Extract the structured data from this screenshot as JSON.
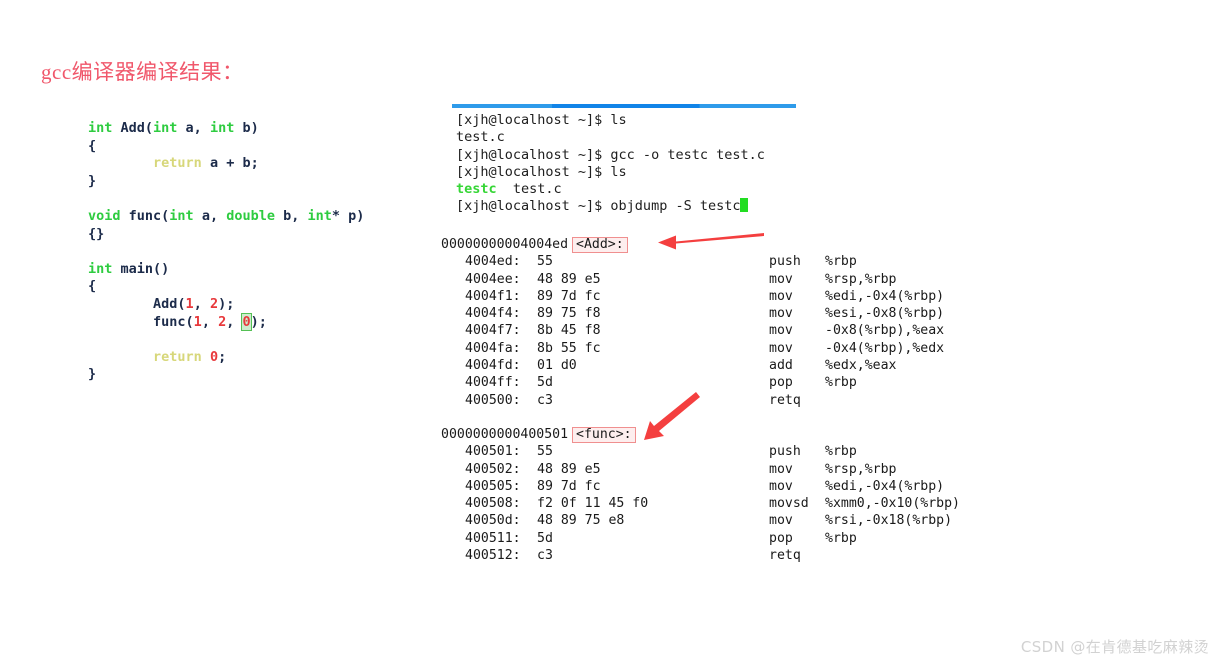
{
  "slide": {
    "title": "gcc编译器编译结果：",
    "title_color": "#f0576b"
  },
  "source_code": {
    "language": "c",
    "lines": [
      [
        {
          "t": "int",
          "c": "kw"
        },
        {
          "t": " Add(",
          "c": "id"
        },
        {
          "t": "int",
          "c": "kw"
        },
        {
          "t": " a, ",
          "c": "id"
        },
        {
          "t": "int",
          "c": "kw"
        },
        {
          "t": " b)",
          "c": "id"
        }
      ],
      [
        {
          "t": "{",
          "c": "id"
        }
      ],
      [
        {
          "t": "        ",
          "c": "id"
        },
        {
          "t": "return",
          "c": "ret"
        },
        {
          "t": " a + b;",
          "c": "id"
        }
      ],
      [
        {
          "t": "}",
          "c": "id"
        }
      ],
      [],
      [
        {
          "t": "void",
          "c": "kw"
        },
        {
          "t": " func(",
          "c": "id"
        },
        {
          "t": "int",
          "c": "kw"
        },
        {
          "t": " a, ",
          "c": "id"
        },
        {
          "t": "double",
          "c": "kw"
        },
        {
          "t": " b, ",
          "c": "id"
        },
        {
          "t": "int",
          "c": "kw"
        },
        {
          "t": "* p)",
          "c": "id"
        }
      ],
      [
        {
          "t": "{}",
          "c": "id"
        }
      ],
      [],
      [
        {
          "t": "int",
          "c": "kw"
        },
        {
          "t": " main()",
          "c": "id"
        }
      ],
      [
        {
          "t": "{",
          "c": "id"
        }
      ],
      [
        {
          "t": "        Add(",
          "c": "id"
        },
        {
          "t": "1",
          "c": "num"
        },
        {
          "t": ", ",
          "c": "id"
        },
        {
          "t": "2",
          "c": "num"
        },
        {
          "t": ");",
          "c": "id"
        }
      ],
      [
        {
          "t": "        func(",
          "c": "id"
        },
        {
          "t": "1",
          "c": "num"
        },
        {
          "t": ", ",
          "c": "id"
        },
        {
          "t": "2",
          "c": "num"
        },
        {
          "t": ", ",
          "c": "id"
        },
        {
          "t": "0",
          "c": "hl-zero"
        },
        {
          "t": ");",
          "c": "id"
        }
      ],
      [],
      [
        {
          "t": "        ",
          "c": "id"
        },
        {
          "t": "return",
          "c": "ret"
        },
        {
          "t": " ",
          "c": "id"
        },
        {
          "t": "0",
          "c": "num"
        },
        {
          "t": ";",
          "c": "id"
        }
      ],
      [
        {
          "t": "}",
          "c": "id"
        }
      ]
    ]
  },
  "terminal": {
    "prompt": "[xjh@localhost ~]$",
    "lines": [
      [
        {
          "t": "[xjh@localhost ~]$ ls",
          "c": "plain"
        }
      ],
      [
        {
          "t": "test.c",
          "c": "plain"
        }
      ],
      [
        {
          "t": "[xjh@localhost ~]$ gcc -o testc test.c",
          "c": "plain"
        }
      ],
      [
        {
          "t": "[xjh@localhost ~]$ ls",
          "c": "plain"
        }
      ],
      [
        {
          "t": "testc",
          "c": "exe"
        },
        {
          "t": "  test.c",
          "c": "plain"
        }
      ],
      [
        {
          "t": "[xjh@localhost ~]$ objdump -S testc",
          "c": "plain"
        },
        {
          "t": "",
          "c": "cursor"
        }
      ]
    ],
    "executable_color": "#36d636",
    "cursor_color": "#22dd22"
  },
  "disassembly": [
    {
      "id": "add",
      "address": "00000000004004ed",
      "symbol": "<Add>:",
      "instructions": [
        {
          "addr": "4004ed:",
          "bytes": "55",
          "mnemonic": "push",
          "operands": "%rbp"
        },
        {
          "addr": "4004ee:",
          "bytes": "48 89 e5",
          "mnemonic": "mov",
          "operands": "%rsp,%rbp"
        },
        {
          "addr": "4004f1:",
          "bytes": "89 7d fc",
          "mnemonic": "mov",
          "operands": "%edi,-0x4(%rbp)"
        },
        {
          "addr": "4004f4:",
          "bytes": "89 75 f8",
          "mnemonic": "mov",
          "operands": "%esi,-0x8(%rbp)"
        },
        {
          "addr": "4004f7:",
          "bytes": "8b 45 f8",
          "mnemonic": "mov",
          "operands": "-0x8(%rbp),%eax"
        },
        {
          "addr": "4004fa:",
          "bytes": "8b 55 fc",
          "mnemonic": "mov",
          "operands": "-0x4(%rbp),%edx"
        },
        {
          "addr": "4004fd:",
          "bytes": "01 d0",
          "mnemonic": "add",
          "operands": "%edx,%eax"
        },
        {
          "addr": "4004ff:",
          "bytes": "5d",
          "mnemonic": "pop",
          "operands": "%rbp"
        },
        {
          "addr": "400500:",
          "bytes": "c3",
          "mnemonic": "retq",
          "operands": ""
        }
      ]
    },
    {
      "id": "func",
      "address": "0000000000400501",
      "symbol": "<func>:",
      "instructions": [
        {
          "addr": "400501:",
          "bytes": "55",
          "mnemonic": "push",
          "operands": "%rbp"
        },
        {
          "addr": "400502:",
          "bytes": "48 89 e5",
          "mnemonic": "mov",
          "operands": "%rsp,%rbp"
        },
        {
          "addr": "400505:",
          "bytes": "89 7d fc",
          "mnemonic": "mov",
          "operands": "%edi,-0x4(%rbp)"
        },
        {
          "addr": "400508:",
          "bytes": "f2 0f 11 45 f0",
          "mnemonic": "movsd",
          "operands": "%xmm0,-0x10(%rbp)"
        },
        {
          "addr": "40050d:",
          "bytes": "48 89 75 e8",
          "mnemonic": "mov",
          "operands": "%rsi,-0x18(%rbp)"
        },
        {
          "addr": "400511:",
          "bytes": "5d",
          "mnemonic": "pop",
          "operands": "%rbp"
        },
        {
          "addr": "400512:",
          "bytes": "c3",
          "mnemonic": "retq",
          "operands": ""
        }
      ]
    }
  ],
  "annotations": {
    "arrow_color": "#f43f3f",
    "symbol_box_border": "#f08f8f",
    "symbol_box_fill": "#fdeeee"
  },
  "watermark": {
    "text": "CSDN @在肯德基吃麻辣烫",
    "color": "#d2d2d2"
  }
}
